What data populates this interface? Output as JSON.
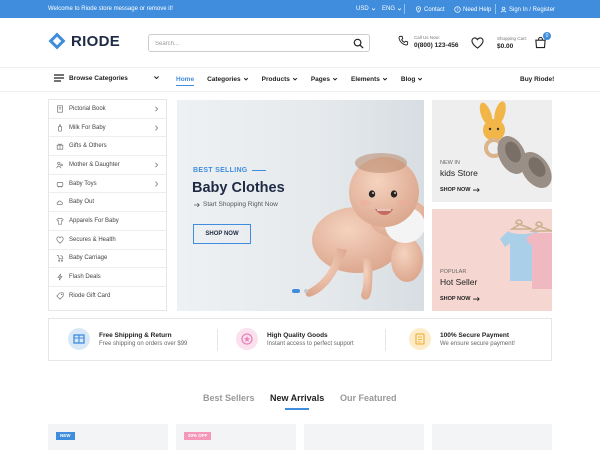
{
  "topbar": {
    "welcome": "Welcome to Riode store message or remove it!",
    "currency": "USD",
    "language": "ENG",
    "contact": "Contact",
    "help": "Need Help",
    "account": "Sign In / Register"
  },
  "header": {
    "logo": "RIODE",
    "search_placeholder": "Search...",
    "call_label": "Call Us Now:",
    "call_number": "0(800) 123-456",
    "cart_label": "Shopping Cart:",
    "cart_total": "$0.00",
    "cart_count": "0"
  },
  "nav": {
    "browse": "Browse Categories",
    "items": [
      {
        "label": "Home"
      },
      {
        "label": "Categories"
      },
      {
        "label": "Products"
      },
      {
        "label": "Pages"
      },
      {
        "label": "Elements"
      },
      {
        "label": "Blog"
      }
    ],
    "buy": "Buy Riode!"
  },
  "sidebar": {
    "items": [
      {
        "label": "Pictorial Book"
      },
      {
        "label": "Milk For Baby"
      },
      {
        "label": "Gifts & Others"
      },
      {
        "label": "Mother & Daughter"
      },
      {
        "label": "Baby Toys"
      },
      {
        "label": "Baby Out"
      },
      {
        "label": "Apparels For Baby"
      },
      {
        "label": "Secures & Health"
      },
      {
        "label": "Baby Carriage"
      },
      {
        "label": "Flash Deals"
      },
      {
        "label": "Riode Gift Card"
      }
    ]
  },
  "hero": {
    "tag": "BEST SELLING",
    "title": "Baby Clothes",
    "subtitle": "Start Shopping Right Now",
    "button": "SHOP NOW"
  },
  "promos": [
    {
      "kicker": "NEW IN",
      "title": "kids Store",
      "button": "SHOP NOW"
    },
    {
      "kicker": "POPULAR",
      "title": "Hot Seller",
      "button": "SHOP NOW"
    }
  ],
  "features": [
    {
      "title": "Free Shipping & Return",
      "subtitle": "Free shipping on orders over $99",
      "color": "#3f8ddc"
    },
    {
      "title": "High Quality Goods",
      "subtitle": "Instant access to perfect support",
      "color": "#e985b8"
    },
    {
      "title": "100% Secure Payment",
      "subtitle": "We ensure secure payment!",
      "color": "#f2b548"
    }
  ],
  "tabs": {
    "items": [
      {
        "label": "Best Sellers"
      },
      {
        "label": "New Arrivals"
      },
      {
        "label": "Our Featured"
      }
    ]
  },
  "products": {
    "badges": [
      "NEW",
      "20% OFF"
    ]
  },
  "colors": {
    "accent": "#3f8ddc",
    "sale": "#f497b9"
  }
}
